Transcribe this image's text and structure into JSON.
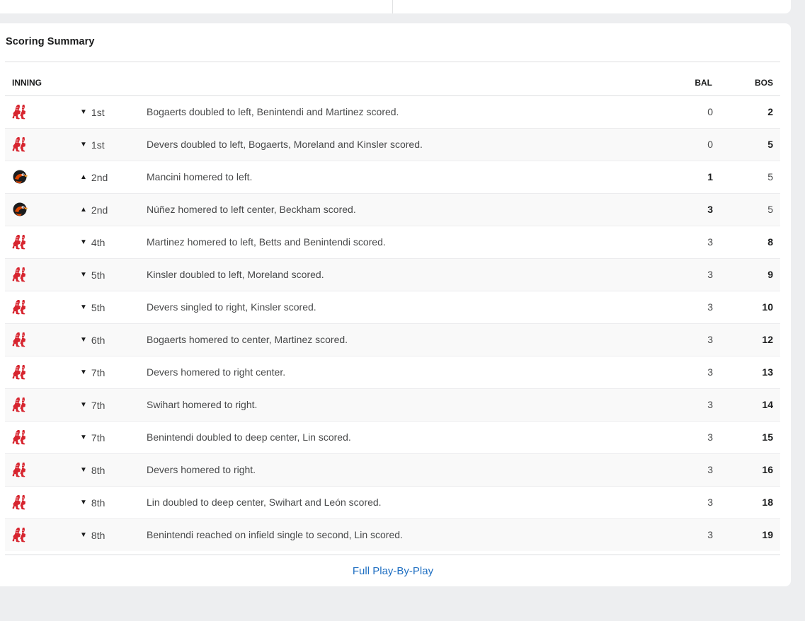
{
  "section_title": "Scoring Summary",
  "table": {
    "headers": {
      "inning": "INNING",
      "away": "BAL",
      "home": "BOS"
    },
    "rows": [
      {
        "team": "BOS",
        "half": "bottom",
        "inning": "1st",
        "play": "Bogaerts doubled to left, Benintendi and Martinez scored.",
        "away_score": "0",
        "home_score": "2"
      },
      {
        "team": "BOS",
        "half": "bottom",
        "inning": "1st",
        "play": "Devers doubled to left, Bogaerts, Moreland and Kinsler scored.",
        "away_score": "0",
        "home_score": "5"
      },
      {
        "team": "BAL",
        "half": "top",
        "inning": "2nd",
        "play": "Mancini homered to left.",
        "away_score": "1",
        "home_score": "5"
      },
      {
        "team": "BAL",
        "half": "top",
        "inning": "2nd",
        "play": "Núñez homered to left center, Beckham scored.",
        "away_score": "3",
        "home_score": "5"
      },
      {
        "team": "BOS",
        "half": "bottom",
        "inning": "4th",
        "play": "Martinez homered to left, Betts and Benintendi scored.",
        "away_score": "3",
        "home_score": "8"
      },
      {
        "team": "BOS",
        "half": "bottom",
        "inning": "5th",
        "play": "Kinsler doubled to left, Moreland scored.",
        "away_score": "3",
        "home_score": "9"
      },
      {
        "team": "BOS",
        "half": "bottom",
        "inning": "5th",
        "play": "Devers singled to right, Kinsler scored.",
        "away_score": "3",
        "home_score": "10"
      },
      {
        "team": "BOS",
        "half": "bottom",
        "inning": "6th",
        "play": "Bogaerts homered to center, Martinez scored.",
        "away_score": "3",
        "home_score": "12"
      },
      {
        "team": "BOS",
        "half": "bottom",
        "inning": "7th",
        "play": "Devers homered to right center.",
        "away_score": "3",
        "home_score": "13"
      },
      {
        "team": "BOS",
        "half": "bottom",
        "inning": "7th",
        "play": "Swihart homered to right.",
        "away_score": "3",
        "home_score": "14"
      },
      {
        "team": "BOS",
        "half": "bottom",
        "inning": "7th",
        "play": "Benintendi doubled to deep center, Lin scored.",
        "away_score": "3",
        "home_score": "15"
      },
      {
        "team": "BOS",
        "half": "bottom",
        "inning": "8th",
        "play": "Devers homered to right.",
        "away_score": "3",
        "home_score": "16"
      },
      {
        "team": "BOS",
        "half": "bottom",
        "inning": "8th",
        "play": "Lin doubled to deep center, Swihart and León scored.",
        "away_score": "3",
        "home_score": "18"
      },
      {
        "team": "BOS",
        "half": "bottom",
        "inning": "8th",
        "play": "Benintendi reached on infield single to second, Lin scored.",
        "away_score": "3",
        "home_score": "19"
      }
    ]
  },
  "footer_link": "Full Play-By-Play",
  "colors": {
    "page_bg": "#edeef0",
    "card_bg": "#ffffff",
    "link": "#1f6fc2",
    "red_sox": "#d7252f",
    "orioles_orange": "#df4601",
    "orioles_black": "#1b1c1d"
  },
  "icons": {
    "BOS": "red-sox-logo-icon",
    "BAL": "orioles-logo-icon",
    "top": "triangle-up-icon",
    "bottom": "triangle-down-icon"
  }
}
